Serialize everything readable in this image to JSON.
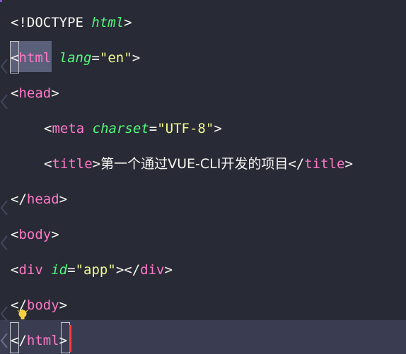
{
  "editor": {
    "lines": [
      {
        "parts": [
          [
            "p",
            "<!DOCTYPE "
          ],
          [
            "dt",
            "html"
          ],
          [
            "p",
            ">"
          ]
        ]
      },
      {
        "parts": [
          [
            "p",
            "<"
          ],
          [
            "t",
            "html"
          ],
          [
            "p",
            " "
          ],
          [
            "a",
            "lang"
          ],
          [
            "p",
            "="
          ],
          [
            "q",
            "\""
          ],
          [
            "s",
            "en"
          ],
          [
            "q",
            "\""
          ],
          [
            "p",
            ">"
          ]
        ]
      },
      {
        "parts": [
          [
            "p",
            "<"
          ],
          [
            "t",
            "head"
          ],
          [
            "p",
            ">"
          ]
        ]
      },
      {
        "parts": [
          [
            "p",
            "<"
          ],
          [
            "t",
            "meta"
          ],
          [
            "p",
            " "
          ],
          [
            "a",
            "charset"
          ],
          [
            "p",
            "="
          ],
          [
            "q",
            "\""
          ],
          [
            "s",
            "UTF-8"
          ],
          [
            "q",
            "\""
          ],
          [
            "p",
            ">"
          ]
        ]
      },
      {
        "parts": [
          [
            "p",
            "<"
          ],
          [
            "t",
            "title"
          ],
          [
            "p",
            ">"
          ],
          [
            "tx",
            "第一个通过VUE-CLI开发的项目"
          ],
          [
            "p",
            "</"
          ],
          [
            "t",
            "title"
          ],
          [
            "p",
            ">"
          ]
        ]
      },
      {
        "parts": [
          [
            "p",
            "</"
          ],
          [
            "t",
            "head"
          ],
          [
            "p",
            ">"
          ]
        ]
      },
      {
        "parts": [
          [
            "p",
            "<"
          ],
          [
            "t",
            "body"
          ],
          [
            "p",
            ">"
          ]
        ]
      },
      {
        "parts": [
          [
            "p",
            "<"
          ],
          [
            "t",
            "div"
          ],
          [
            "p",
            " "
          ],
          [
            "a",
            "id"
          ],
          [
            "p",
            "="
          ],
          [
            "q",
            "\""
          ],
          [
            "s",
            "app"
          ],
          [
            "q",
            "\""
          ],
          [
            "p",
            "></"
          ],
          [
            "t",
            "div"
          ],
          [
            "p",
            ">"
          ]
        ]
      },
      {
        "parts": [
          [
            "p",
            "</"
          ],
          [
            "t",
            "body"
          ],
          [
            "p",
            ">"
          ]
        ]
      },
      {
        "parts": [
          [
            "p",
            "</"
          ],
          [
            "t",
            "html"
          ],
          [
            "p",
            ">"
          ]
        ]
      }
    ]
  },
  "colors": {
    "background": "#282a36",
    "current_line": "#3a3d52",
    "tag": "#ff79c6",
    "attribute": "#50fa7b",
    "string": "#f1fa8c",
    "caret": "#ff3b3b",
    "selection": "#5a5f7a"
  },
  "icons": {
    "lightbulb": "lightbulb-icon",
    "fold": "fold-chevron-icon"
  }
}
